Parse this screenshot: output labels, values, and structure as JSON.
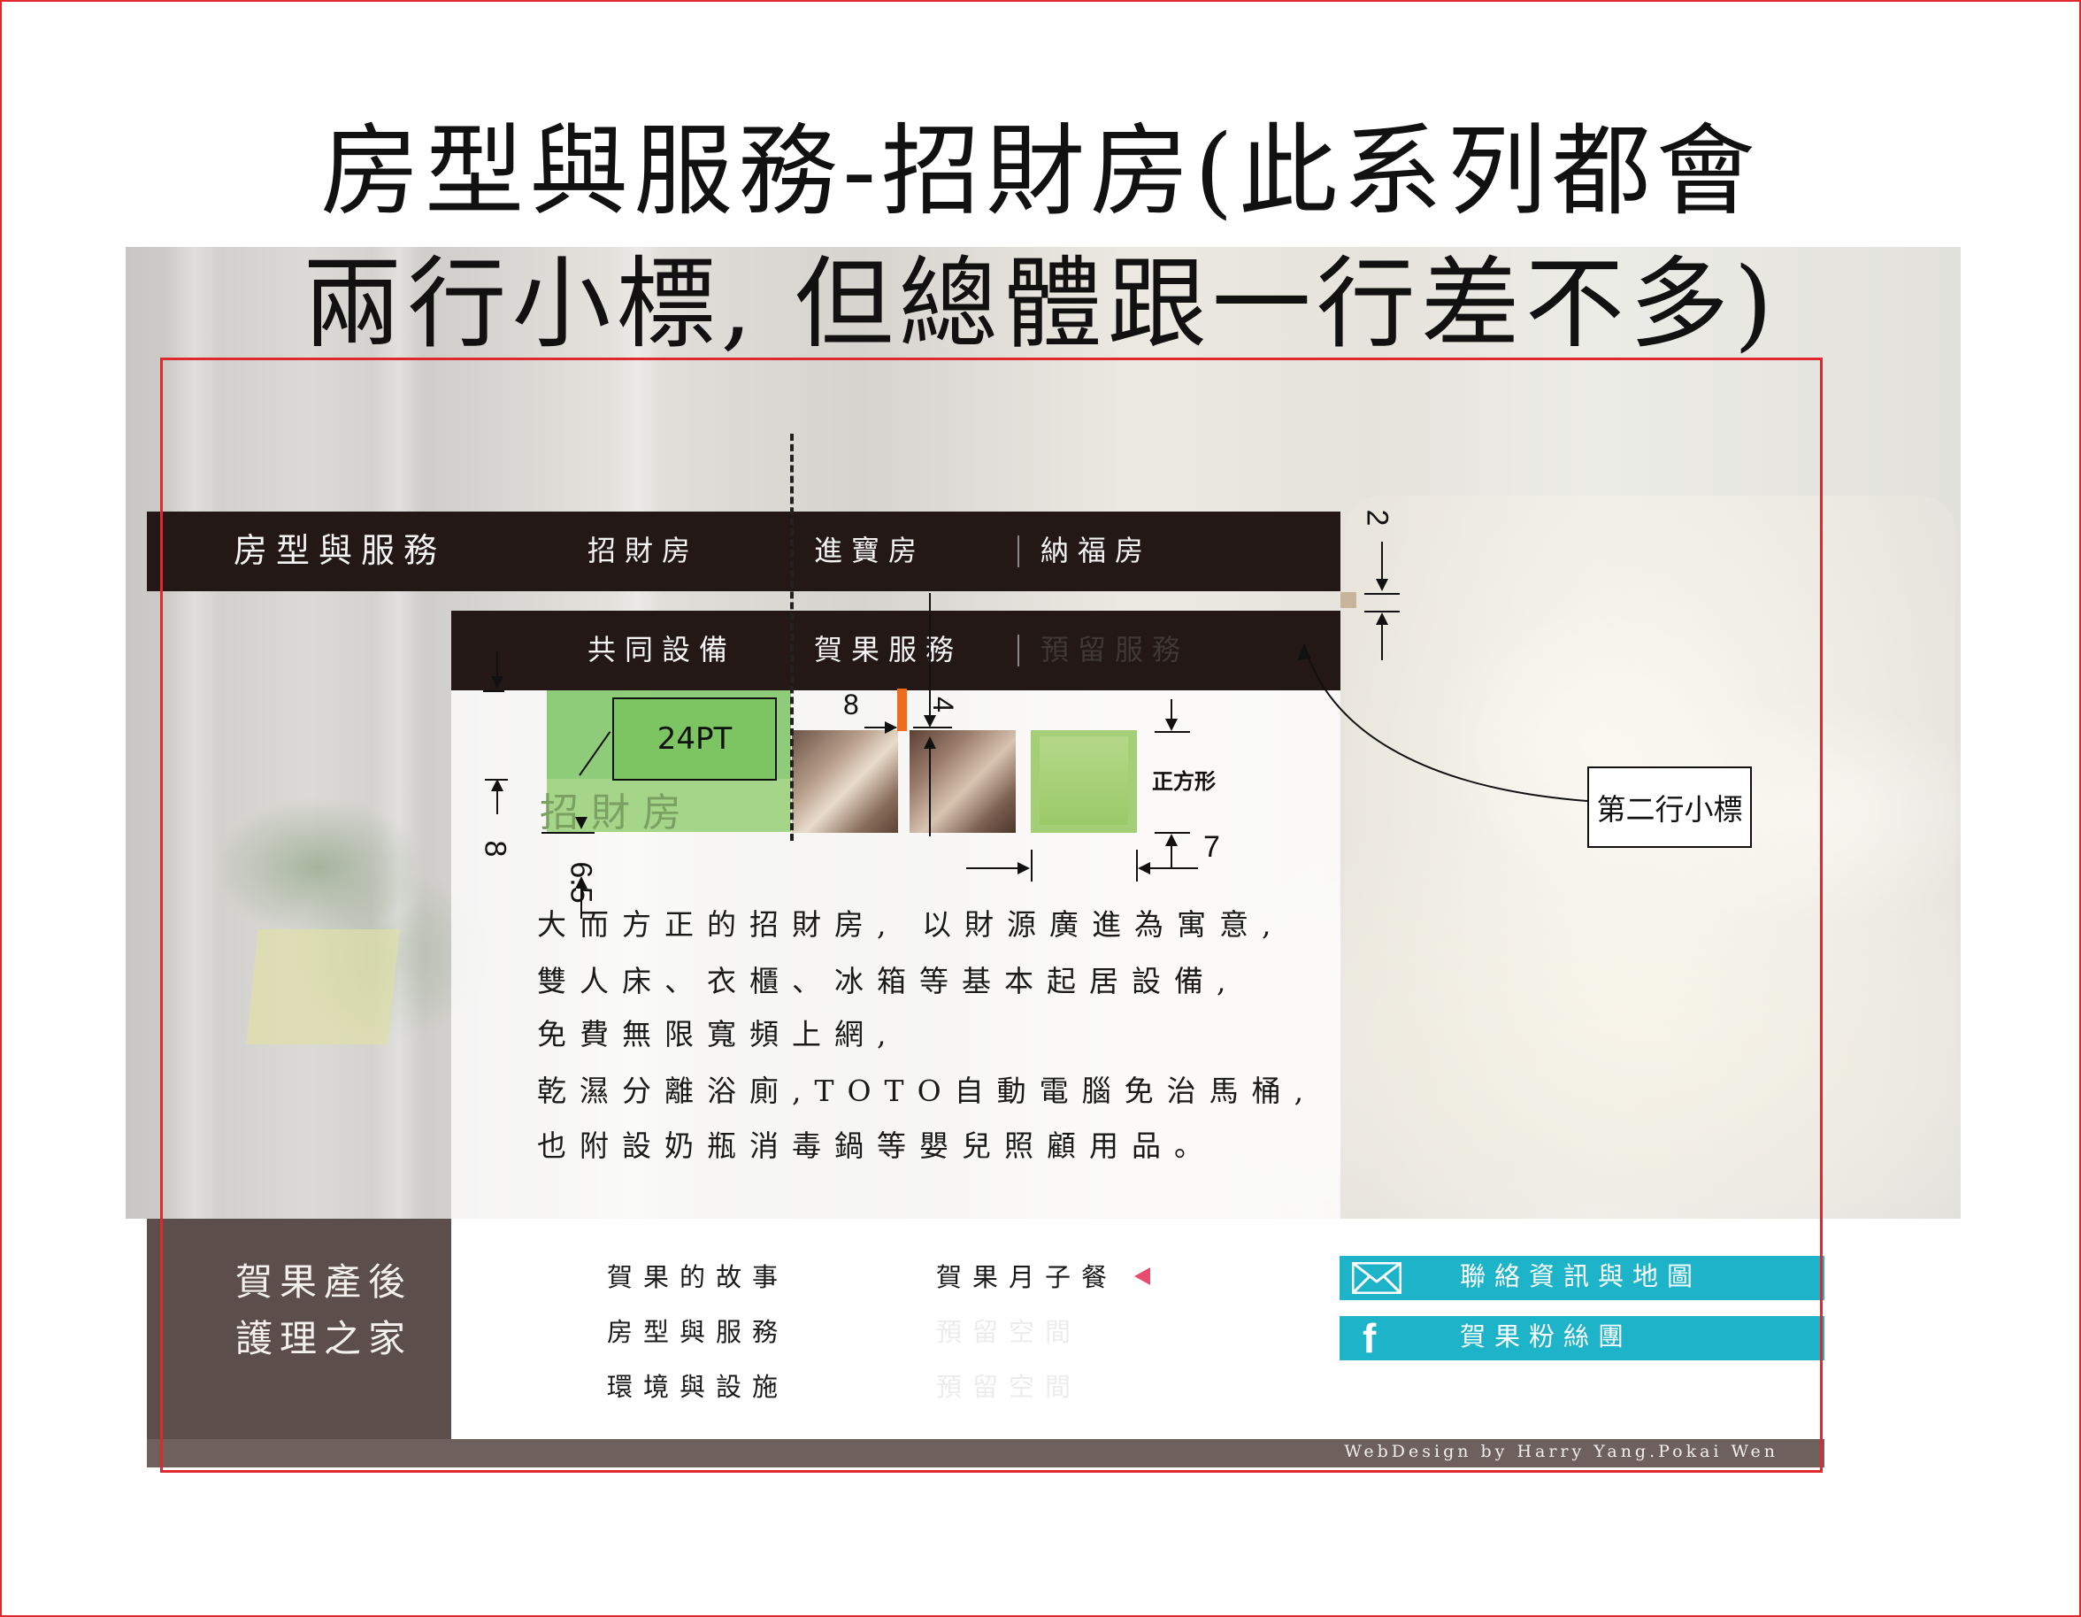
{
  "title": {
    "line1": "房型與服務-招財房(此系列都會",
    "line2": "兩行小標, 但總體跟一行差不多)"
  },
  "nav": {
    "section_title": "房型與服務",
    "row1": [
      "招財房",
      "進寶房",
      "納福房"
    ],
    "row2": [
      "共同設備",
      "賀果服務",
      "預留服務"
    ]
  },
  "room": {
    "title": "招財房",
    "size_label": "24PT",
    "description": [
      "大而方正的招財房, 以財源廣進為寓意,",
      "雙人床、衣櫃、冰箱等基本起居設備,",
      "免費無限寬頻上網,",
      "乾濕分離浴廁,TOTO自動電腦免治馬桶,",
      "也附設奶瓶消毒鍋等嬰兒照顧用品。"
    ]
  },
  "annotations": {
    "gap_2": "2",
    "gap_8_left": "8",
    "gap_6_5": "6.5",
    "gap_8_top": "8",
    "gap_4": "4",
    "gap_7": "7",
    "square": "正方形",
    "second_subtitle": "第二行小標"
  },
  "footer": {
    "brand_line1": "賀果產後",
    "brand_line2": "護理之家",
    "col1": [
      "賀果的故事",
      "房型與服務",
      "環境與設施"
    ],
    "col2": [
      "賀果月子餐",
      "預留空間",
      "預留空間"
    ],
    "contact_label": "聯絡資訊與地圖",
    "fans_label": "賀果粉絲團",
    "credit": "WebDesign by Harry Yang.Pokai Wen"
  },
  "colors": {
    "nav_bg": "#231815",
    "accent_green": "#7dc463",
    "accent_teal": "#1db3c9",
    "accent_orange": "#ee6c1d",
    "frame_red": "#e0282e",
    "footer_brown": "#5c4f4b"
  },
  "icons": {
    "contact": "envelope-icon",
    "fans": "facebook-icon",
    "active_marker": "triangle-left-icon"
  }
}
